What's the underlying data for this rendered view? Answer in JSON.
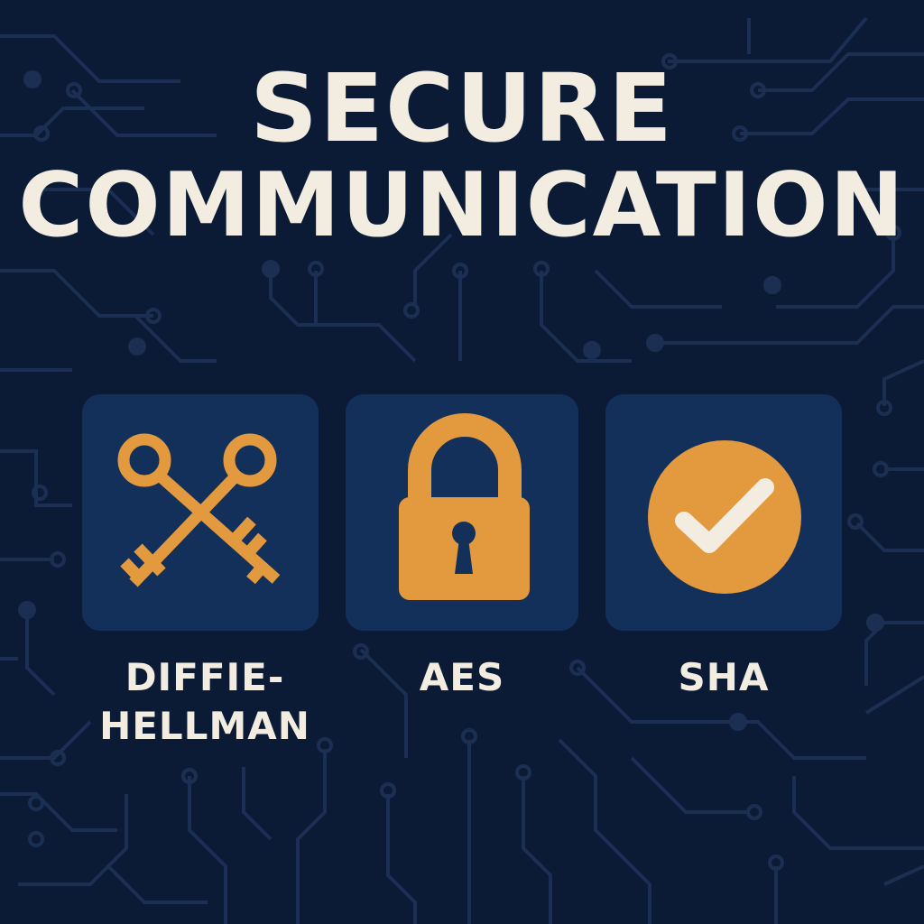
{
  "title": {
    "line1": "SECURE",
    "line2": "COMMUNICATION"
  },
  "items": [
    {
      "label_line1": "DIFFIE-",
      "label_line2": "HELLMAN",
      "icon": "crossed-keys-icon"
    },
    {
      "label": "AES",
      "icon": "padlock-icon"
    },
    {
      "label": "SHA",
      "icon": "checkmark-circle-icon"
    }
  ],
  "colors": {
    "background": "#0b1b35",
    "tile": "#13305a",
    "accent": "#e39a3e",
    "text": "#f3ede1",
    "circuit": "#1a2f52"
  }
}
